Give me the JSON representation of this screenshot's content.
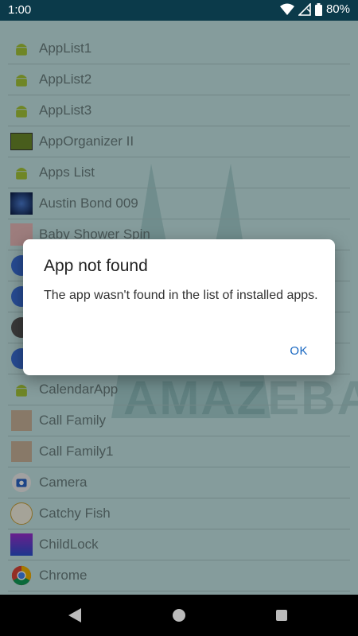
{
  "status_bar": {
    "time": "1:00",
    "battery": "80%",
    "icons": [
      "wifi-icon",
      "signal-icon",
      "battery-icon"
    ]
  },
  "watermark_text": "AMAZEBABA",
  "apps": [
    {
      "label": "AppList1",
      "icon": "android-icon"
    },
    {
      "label": "AppList2",
      "icon": "android-icon"
    },
    {
      "label": "AppList3",
      "icon": "android-icon"
    },
    {
      "label": "AppOrganizer II",
      "icon": "apporganizer-icon"
    },
    {
      "label": "Apps List",
      "icon": "android-icon"
    },
    {
      "label": "Austin Bond 009",
      "icon": "austin-bond-icon"
    },
    {
      "label": "Baby Shower Spin",
      "icon": "baby-shower-icon"
    },
    {
      "label": "",
      "icon": "app-icon"
    },
    {
      "label": "",
      "icon": "app-icon"
    },
    {
      "label": "",
      "icon": "calculator-icon"
    },
    {
      "label": "",
      "icon": "app-icon"
    },
    {
      "label": "CalendarApp",
      "icon": "android-icon"
    },
    {
      "label": "Call Family",
      "icon": "call-family-icon"
    },
    {
      "label": "Call Family1",
      "icon": "call-family-icon"
    },
    {
      "label": "Camera",
      "icon": "camera-icon"
    },
    {
      "label": "Catchy Fish",
      "icon": "catchy-fish-icon"
    },
    {
      "label": "ChildLock",
      "icon": "childlock-icon"
    },
    {
      "label": "Chrome",
      "icon": "chrome-icon"
    }
  ],
  "dialog": {
    "title": "App not found",
    "message": "The app wasn't found in the list of installed apps.",
    "ok_label": "OK"
  },
  "colors": {
    "status_bar": "#0b3a4a",
    "list_background": "#c4e6e6",
    "dialog_accent": "#1565c0"
  }
}
